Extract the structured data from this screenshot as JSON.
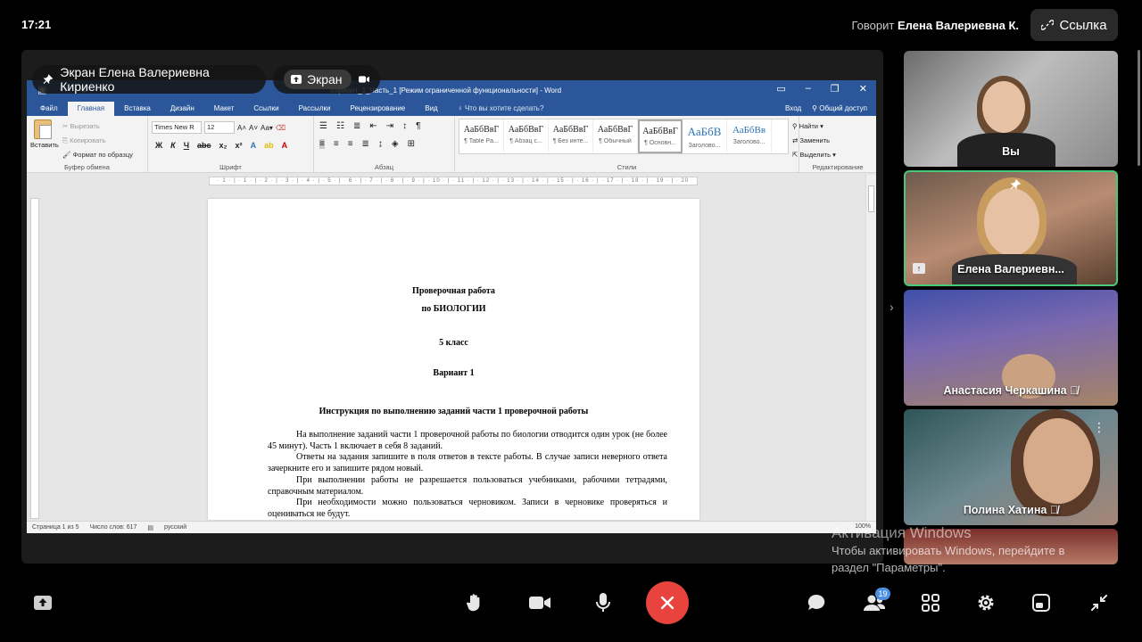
{
  "top": {
    "time": "17:21",
    "speaking_prefix": "Говорит",
    "speaking_name": "Елена Валериевна К.",
    "link_label": "Ссылка"
  },
  "share": {
    "presenter_label": "Экран Елена Валериевна Кириенко",
    "screen_label": "Экран"
  },
  "word": {
    "title": "Вариант_1_Часть_1 [Режим ограниченной функциональности] - Word",
    "tabs": [
      "Файл",
      "Главная",
      "Вставка",
      "Дизайн",
      "Макет",
      "Ссылки",
      "Рассылки",
      "Рецензирование",
      "Вид"
    ],
    "tell_me": "Что вы хотите сделать?",
    "signin": "Вход",
    "share": "Общий доступ",
    "clipboard": {
      "paste": "Вставить",
      "cut": "Вырезать",
      "copy": "Копировать",
      "format_painter": "Формат по образцу",
      "group": "Буфер обмена"
    },
    "font": {
      "name": "Times New R",
      "size": "12",
      "group": "Шрифт"
    },
    "paragraph_group": "Абзац",
    "styles": [
      {
        "sample": "АаБбВвГ",
        "name": "¶ Table Pa..."
      },
      {
        "sample": "АаБбВвГ",
        "name": "¶ Абзац с..."
      },
      {
        "sample": "АаБбВвГ",
        "name": "¶ Без инте..."
      },
      {
        "sample": "АаБбВвГ",
        "name": "¶ Обычный"
      },
      {
        "sample": "АаБбВвГ",
        "name": "¶ Основн..."
      },
      {
        "sample": "АаБбВ",
        "name": "Заголово..."
      },
      {
        "sample": "АаБбВв",
        "name": "Заголово..."
      }
    ],
    "styles_group": "Стили",
    "editing": {
      "find": "Найти",
      "replace": "Заменить",
      "select": "Выделить",
      "group": "Редактирование"
    },
    "ruler_text": "· 1 · | · 1 · | · 2 · | · 3 · | · 4 · | · 5 · | · 6 · | · 7 · | · 8 · | · 9 · | · 10 · | · 11 · | · 12 · | · 13 · | · 14 · | · 15 · | · 16 · | · 17 · | · 18 · | · 19 · | · 20",
    "document": {
      "title1": "Проверочная работа",
      "title2": "по БИОЛОГИИ",
      "grade": "5 класс",
      "variant": "Вариант 1",
      "instruction_heading": "Инструкция по выполнению заданий части 1 проверочной работы",
      "paragraphs": [
        "На выполнение заданий части 1 проверочной работы по биологии отводится один урок (не более 45 минут). Часть 1 включает в себя 8 заданий.",
        "Ответы на задания запишите в поля ответов в тексте работы. В случае записи неверного ответа зачеркните его и запишите рядом новый.",
        "При выполнении работы не разрешается пользоваться учебниками, рабочими тетрадями, справочным материалом.",
        "При необходимости можно пользоваться черновиком. Записи в черновике проверяться и оцениваться не будут."
      ]
    },
    "status": {
      "page": "Страница 1 из 5",
      "words": "Число слов: 617",
      "language": "русский",
      "zoom": "100%"
    }
  },
  "participants": [
    {
      "name": "Вы"
    },
    {
      "name": "Елена Валериевн..."
    },
    {
      "name": "Анастасия Черкашина"
    },
    {
      "name": "Полина Хатина"
    }
  ],
  "watermark": {
    "title": "Активация Windows",
    "line1": "Чтобы активировать Windows, перейдите в",
    "line2": "раздел \"Параметры\"."
  },
  "controls": {
    "participants_count": "19"
  },
  "colors": {
    "word_blue": "#2b579a",
    "end_call_red": "#e8443d",
    "active_speaker_border": "#4bc77a",
    "badge_blue": "#4a90e2"
  },
  "icons": [
    "share-screen-icon",
    "raise-hand-icon",
    "camera-icon",
    "microphone-icon",
    "end-call-icon",
    "chat-icon",
    "participants-icon",
    "grid-view-icon",
    "settings-icon",
    "layout-icon",
    "fullscreen-exit-icon",
    "link-icon",
    "pin-icon",
    "mic-off-icon"
  ]
}
